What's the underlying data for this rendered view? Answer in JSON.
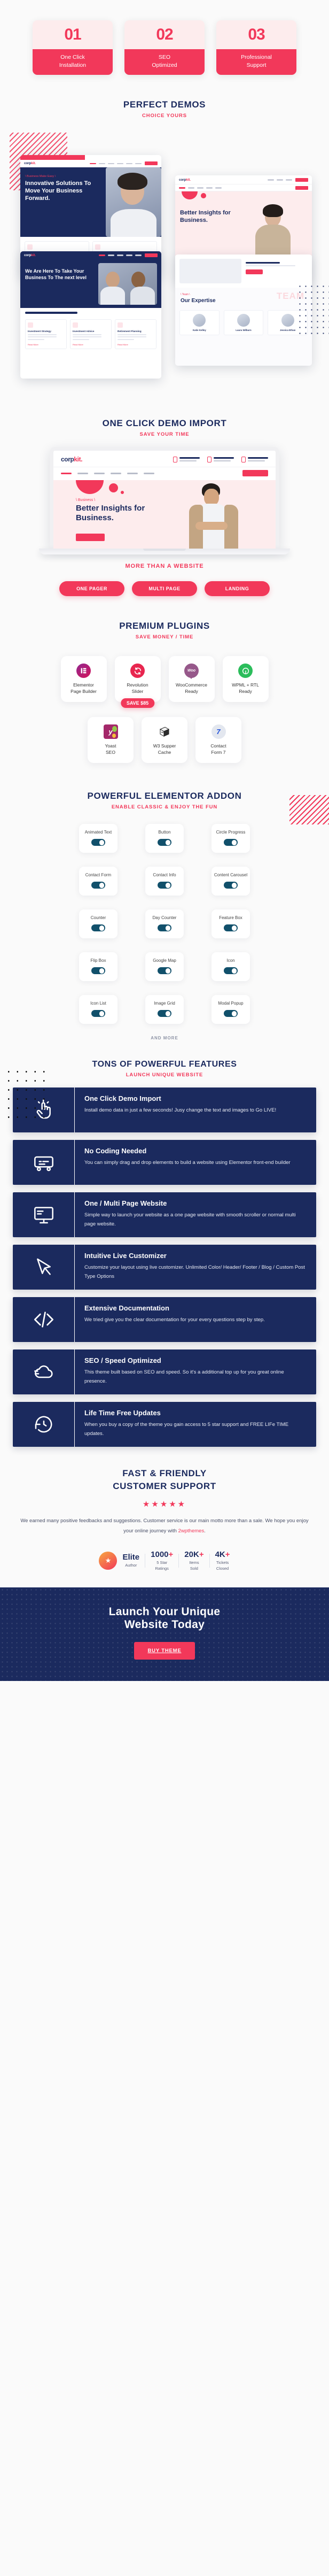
{
  "top_cards": [
    {
      "number": "01",
      "label": "One Click\nInstallation"
    },
    {
      "number": "02",
      "label": "SEO\nOptimized"
    },
    {
      "number": "03",
      "label": "Professional\nSupport"
    }
  ],
  "perfect_demos": {
    "title": "PERFECT DEMOS",
    "subtitle": "CHOICE YOURS",
    "brand": "corp",
    "brand_accent": "kit.",
    "demo1_kicker": "\\ Business Make Easy \\",
    "demo1_heading": "Innovative Solutions To Move Your Business Forward.",
    "demo2_heading": "Better Insights for Business.",
    "demo3_heading": "We Are Here To Take Your Business To The next level",
    "demo3_cards": [
      {
        "title": "Investment Strategy",
        "desc": "Lorem ipsum dolor sit amet, consectetur adipiscing elit, sit et tortus tortus.",
        "link": "Read More"
      },
      {
        "title": "Investment Advice",
        "desc": "Lorem ipsum dolor sit amet, consectetur adipiscing elit, sit et tortus tortus.",
        "link": "Read More"
      },
      {
        "title": "Retirement Planning",
        "desc": "Lorem ipsum dolor sit amet, consectetur adipiscing elit, sit et tortus tortus.",
        "link": "Read More"
      }
    ],
    "demo4_kicker": "\\ Team \\",
    "demo4_heading": "Our Expertise",
    "demo4_watermark": "TEAM",
    "team": [
      {
        "name": "Katie Kelley"
      },
      {
        "name": "Laura Wilburn"
      },
      {
        "name": "Jessica Ethan"
      }
    ]
  },
  "demo_import": {
    "title": "ONE CLICK DEMO IMPORT",
    "subtitle": "SAVE YOUR TIME",
    "laptop": {
      "brand": "corp",
      "brand_accent": "kit.",
      "phone": "(251) 456-7890",
      "phone_sub": "Mon to Fri 08:00 - 11:00",
      "email": "info@example.com",
      "email_sub": "Get a Free Estimate",
      "address": "No 12, Ribon Building,",
      "address_sub": "Walse street, Australia",
      "menu": [
        "Home",
        "Pages",
        "Our Services",
        "Portfolio",
        "Blog",
        "Contact"
      ],
      "cta": "GET IN TOUCH",
      "hero_kicker": "\\ Business \\",
      "hero_heading": "Better Insights for Business.",
      "hero_button": "READ MORE"
    },
    "more_than": "MORE THAN A WEBSITE",
    "pills": [
      "ONE PAGER",
      "MULTI PAGE",
      "LANDING"
    ]
  },
  "premium_plugins": {
    "title": "PREMIUM PLUGINS",
    "subtitle": "SAVE MONEY / TIME",
    "save_badge": "SAVE $85",
    "row1": [
      {
        "name": "Elementor\nPage Builder",
        "icon": "elementor-icon",
        "key": "elementor"
      },
      {
        "name": "Revolution\nSlider",
        "icon": "revolution-slider-icon",
        "key": "revslider"
      },
      {
        "name": "WooCommerce\nReady",
        "icon": "woocommerce-icon",
        "key": "woo"
      },
      {
        "name": "WPML + RTL\nReady",
        "icon": "wpml-icon",
        "key": "wpml"
      }
    ],
    "row2": [
      {
        "name": "Yoast\nSEO",
        "icon": "yoast-seo-icon",
        "key": "yoast"
      },
      {
        "name": "W3 Supper\nCache",
        "icon": "w3-total-cache-icon",
        "key": "w3"
      },
      {
        "name": "Contact\nForm 7",
        "icon": "contact-form-7-icon",
        "key": "cf7"
      }
    ]
  },
  "elementor_addon": {
    "title": "POWERFUL ELEMENTOR ADDON",
    "subtitle": "ENABLE  CLASSIC & ENJOY THE FUN",
    "widgets": [
      "Animated Text",
      "Button",
      "Circle Progress",
      "Contact Form",
      "Contact Info",
      "Content Carousel",
      "Counter",
      "Day Counter",
      "Feature Box",
      "Flip Box",
      "Google Map",
      "Icon",
      "Icon List",
      "Image Grid",
      "Modal Popup"
    ],
    "and_more": "AND MORE"
  },
  "features": {
    "title": "TONS OF POWERFUL FEATURES",
    "subtitle": "LAUNCH UNIQUE WEBSITE",
    "items": [
      {
        "icon": "click-hand-icon",
        "title": "One Click Demo Import",
        "desc": "Install demo data in just a few seconds! Jusy change the text and images to Go LIVE!"
      },
      {
        "icon": "no-code-icon",
        "title": "No Coding Needed",
        "desc": "You can simply drag and drop elements to build a website using Elementor front-end builder"
      },
      {
        "icon": "monitor-icon",
        "title": "One / Multi Page Website",
        "desc": "Simple way to launch your website as a one page website with smooth scroller or normal multi page website."
      },
      {
        "icon": "cursor-customize-icon",
        "title": "Intuitive Live  Customizer",
        "desc": "Customize your layout using live customizer. Unlimited  Color/ Header/ Footer / Blog / Custom Post Type Options"
      },
      {
        "icon": "code-brackets-icon",
        "title": "Extensive Documentation",
        "desc": "We tried give you the clear documentation for your every questions step by step."
      },
      {
        "icon": "cloud-speed-icon",
        "title": "SEO / Speed Optimized",
        "desc": "This theme  built based on SEO and speed. So it's a additional top up for you great online presence."
      },
      {
        "icon": "refresh-clock-icon",
        "title": "Life Time Free Updates",
        "desc": "When you buy a copy of the theme you gain access to 5 star support and FREE LIFe TIME updates."
      }
    ]
  },
  "support": {
    "title_line1": "FAST & FRIENDLY",
    "title_line2": "CUSTOMER SUPPORT",
    "stars": "★★★★★",
    "text_before": "We earned many positive feedbacks and suggestions.  Customer service is our main motto more than a sale. We hope you enjoy your online journey with ",
    "link": "2wpthemes",
    "text_after": "."
  },
  "stats": [
    {
      "badge": "★",
      "big": "Elite",
      "sub": "Author"
    },
    {
      "big": "1000",
      "accent": "+",
      "sub": "5 Star\nRatings"
    },
    {
      "big": "20K",
      "accent": "+",
      "sub": "Items\nSold"
    },
    {
      "big": "4K",
      "accent": "+",
      "sub": "Tickets\nClosed"
    }
  ],
  "cta": {
    "title": "Launch  Your Unique\nWebsite Today",
    "button": "BUY THEME"
  },
  "colors": {
    "accent": "#f2385a",
    "navy": "#1b2a5e",
    "toggle": "#11506b",
    "pink_bg": "#fdeced",
    "page_bg": "#fafafa"
  }
}
